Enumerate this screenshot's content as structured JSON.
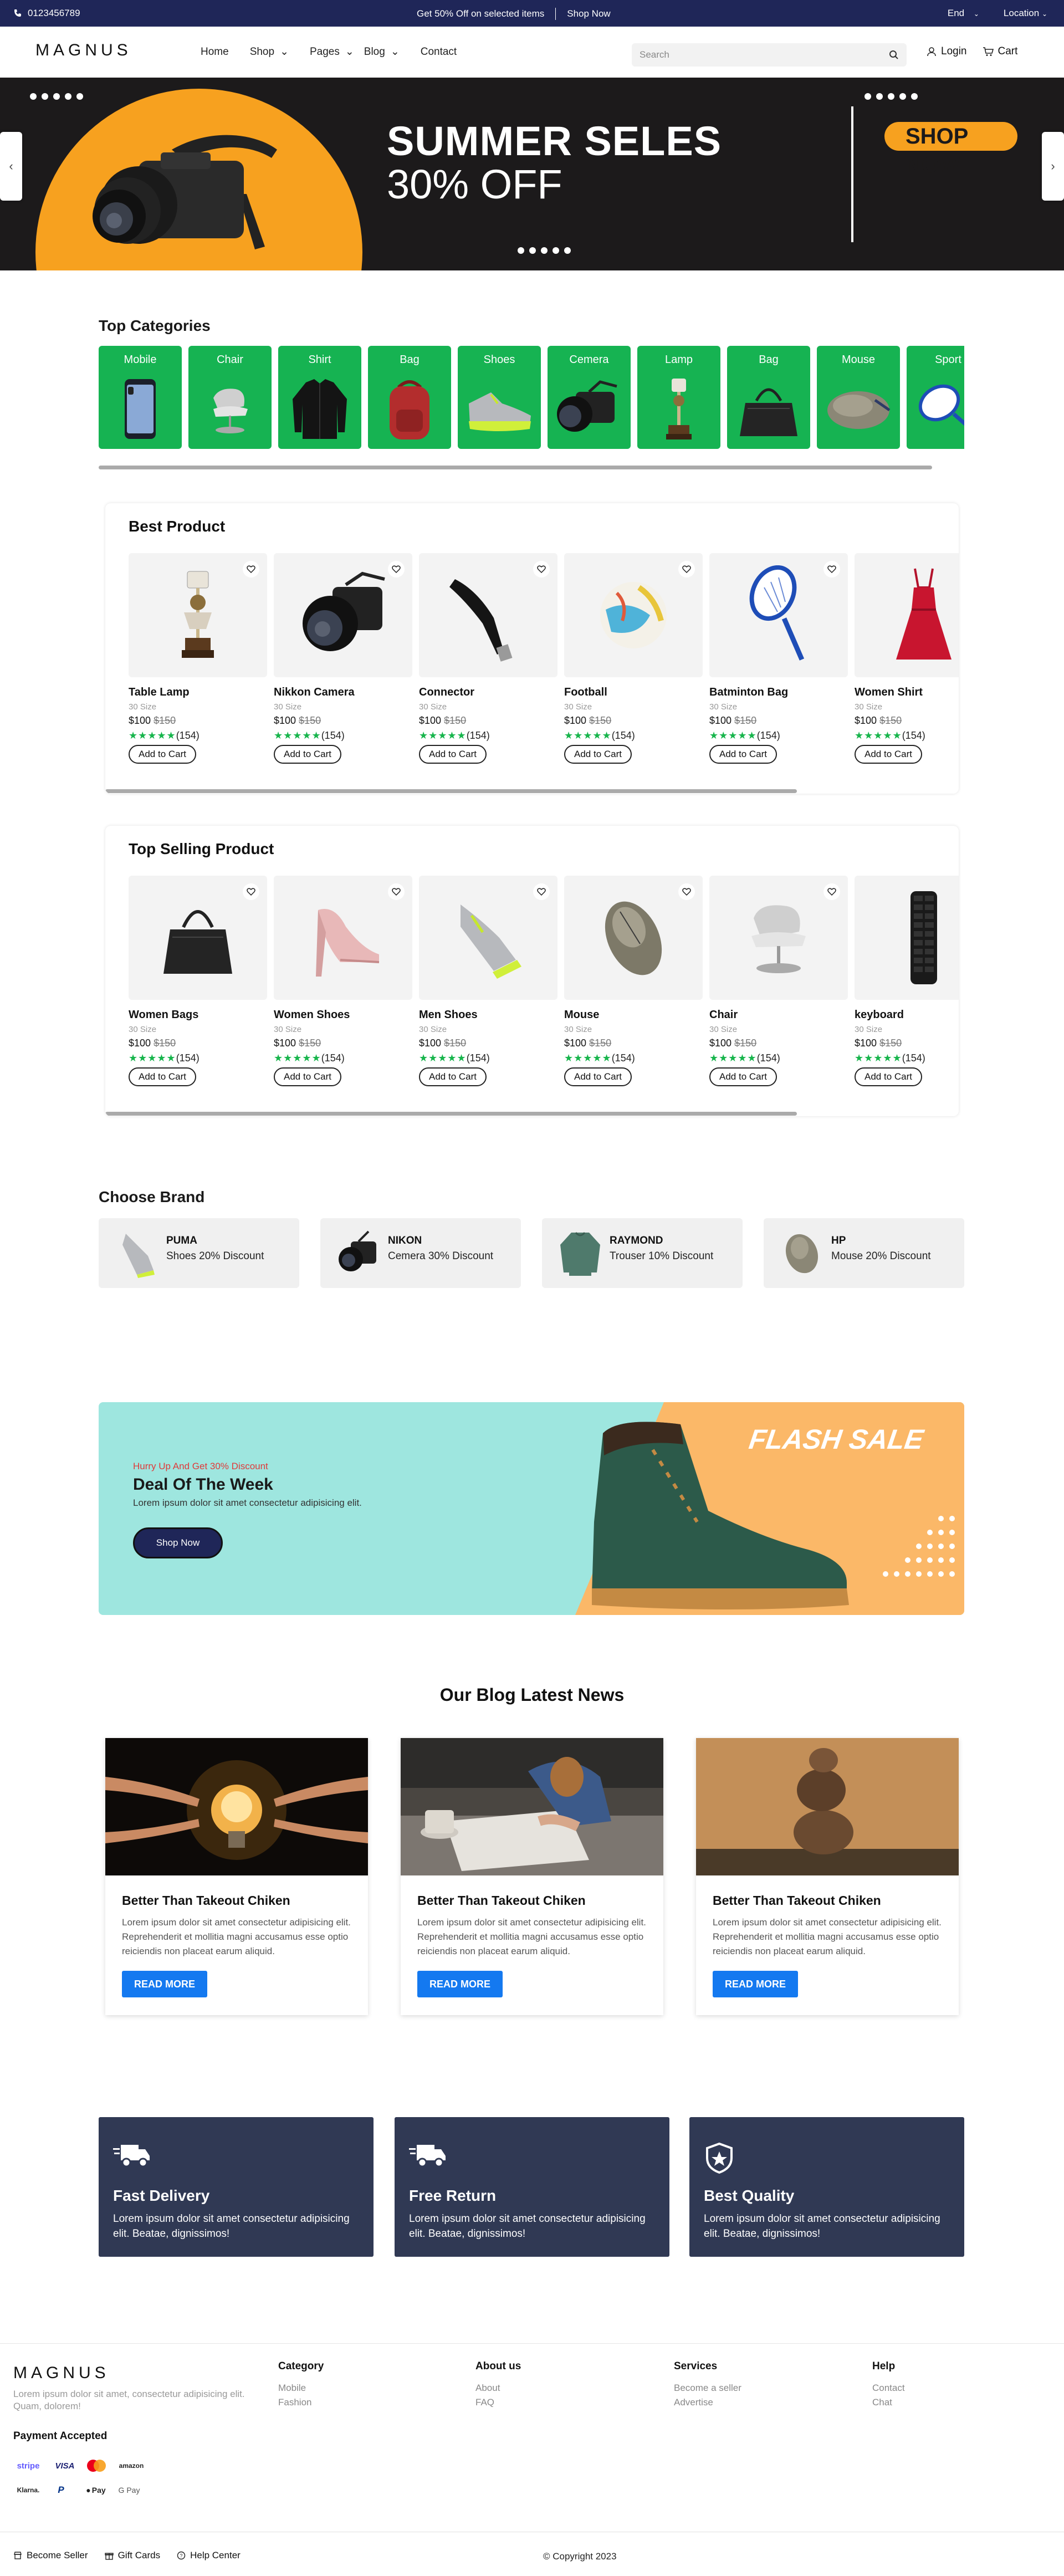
{
  "topbar": {
    "phone": "0123456789",
    "promo": "Get 50% Off on selected items",
    "promo_link": "Shop Now",
    "language": "End",
    "location": "Location"
  },
  "nav": {
    "logo": "MAGNUS",
    "menu": [
      "Home",
      "Shop",
      "Pages",
      "Blog",
      "Contact"
    ],
    "search_placeholder": "Search",
    "login": "Login",
    "cart": "Cart"
  },
  "hero": {
    "title": "SUMMER SELES",
    "subtitle": "30% OFF",
    "cta": "SHOP NOW",
    "colors": {
      "accent": "#f7a11f",
      "bg": "#1c1a1b"
    }
  },
  "categories": {
    "title": "Top Categories",
    "items": [
      "Mobile",
      "Chair",
      "Shirt",
      "Bag",
      "Shoes",
      "Cemera",
      "Lamp",
      "Bag",
      "Mouse",
      "Sport"
    ]
  },
  "best": {
    "title": "Best Product",
    "products": [
      {
        "name": "Table Lamp",
        "size": "30 Size",
        "price": "$100",
        "old": "$150",
        "stars": "★★★★★",
        "reviews": "(154)",
        "btn": "Add to Cart",
        "icon": "lamp"
      },
      {
        "name": "Nikkon Camera",
        "size": "30 Size",
        "price": "$100",
        "old": "$150",
        "stars": "★★★★★",
        "reviews": "(154)",
        "btn": "Add to Cart",
        "icon": "camera"
      },
      {
        "name": "Connector",
        "size": "30 Size",
        "price": "$100",
        "old": "$150",
        "stars": "★★★★★",
        "reviews": "(154)",
        "btn": "Add to Cart",
        "icon": "connector"
      },
      {
        "name": "Football",
        "size": "30 Size",
        "price": "$100",
        "old": "$150",
        "stars": "★★★★★",
        "reviews": "(154)",
        "btn": "Add to Cart",
        "icon": "ball"
      },
      {
        "name": "Batminton Bag",
        "size": "30 Size",
        "price": "$100",
        "old": "$150",
        "stars": "★★★★★",
        "reviews": "(154)",
        "btn": "Add to Cart",
        "icon": "racket"
      },
      {
        "name": "Women Shirt",
        "size": "30 Size",
        "price": "$100",
        "old": "$150",
        "stars": "★★★★★",
        "reviews": "(154)",
        "btn": "Add to Cart",
        "icon": "dress"
      }
    ]
  },
  "selling": {
    "title": "Top Selling Product",
    "products": [
      {
        "name": "Women Bags",
        "size": "30 Size",
        "price": "$100",
        "old": "$150",
        "stars": "★★★★★",
        "reviews": "(154)",
        "btn": "Add to Cart",
        "icon": "bag"
      },
      {
        "name": "Women Shoes",
        "size": "30 Size",
        "price": "$100",
        "old": "$150",
        "stars": "★★★★★",
        "reviews": "(154)",
        "btn": "Add to Cart",
        "icon": "heel"
      },
      {
        "name": "Men Shoes",
        "size": "30 Size",
        "price": "$100",
        "old": "$150",
        "stars": "★★★★★",
        "reviews": "(154)",
        "btn": "Add to Cart",
        "icon": "sneaker"
      },
      {
        "name": "Mouse",
        "size": "30 Size",
        "price": "$100",
        "old": "$150",
        "stars": "★★★★★",
        "reviews": "(154)",
        "btn": "Add to Cart",
        "icon": "mouse"
      },
      {
        "name": "Chair",
        "size": "30 Size",
        "price": "$100",
        "old": "$150",
        "stars": "★★★★★",
        "reviews": "(154)",
        "btn": "Add to Cart",
        "icon": "chair"
      },
      {
        "name": "keyboard",
        "size": "30 Size",
        "price": "$100",
        "old": "$150",
        "stars": "★★★★★",
        "reviews": "(154)",
        "btn": "Add to Cart",
        "icon": "keyboard"
      }
    ]
  },
  "brands": {
    "title": "Choose Brand",
    "items": [
      {
        "name": "PUMA",
        "desc": "Shoes 20% Discount"
      },
      {
        "name": "NIKON",
        "desc": "Cemera 30% Discount"
      },
      {
        "name": "RAYMOND",
        "desc": "Trouser 10% Discount"
      },
      {
        "name": "HP",
        "desc": "Mouse 20% Discount"
      }
    ]
  },
  "deal": {
    "kicker": "Hurry Up And Get 30% Discount",
    "title": "Deal Of The Week",
    "text": "Lorem ipsum dolor sit amet consectetur adipisicing elit.",
    "cta": "Shop Now",
    "badge": "FLASH SALE"
  },
  "blog": {
    "title": "Our Blog Latest News",
    "posts": [
      {
        "title": "Better Than Takeout Chiken",
        "text": "Lorem ipsum dolor sit amet consectetur adipisicing elit. Reprehenderit et mollitia magni accusamus esse optio reiciendis non placeat earum aliquid.",
        "cta": "READ MORE"
      },
      {
        "title": "Better Than Takeout Chiken",
        "text": "Lorem ipsum dolor sit amet consectetur adipisicing elit. Reprehenderit et mollitia magni accusamus esse optio reiciendis non placeat earum aliquid.",
        "cta": "READ MORE"
      },
      {
        "title": "Better Than Takeout Chiken",
        "text": "Lorem ipsum dolor sit amet consectetur adipisicing elit. Reprehenderit et mollitia magni accusamus esse optio reiciendis non placeat earum aliquid.",
        "cta": "READ MORE"
      }
    ]
  },
  "features": [
    {
      "title": "Fast Delivery",
      "text": "Lorem ipsum dolor sit amet consectetur adipisicing elit. Beatae, dignissimos!"
    },
    {
      "title": "Free Return",
      "text": "Lorem ipsum dolor sit amet consectetur adipisicing elit. Beatae, dignissimos!"
    },
    {
      "title": "Best Quality",
      "text": "Lorem ipsum dolor sit amet consectetur adipisicing elit. Beatae, dignissimos!"
    }
  ],
  "footer": {
    "logo": "MAGNUS",
    "about": "Lorem ipsum dolor sit amet, consectetur adipisicing elit. Quam, dolorem!",
    "payment_title": "Payment Accepted",
    "payments": [
      "stripe",
      "VISA",
      "mastercard",
      "amazon",
      "Klarna.",
      "P",
      "Pay",
      "G Pay"
    ],
    "columns": [
      {
        "title": "Category",
        "links": [
          "Mobile",
          "Fashion"
        ]
      },
      {
        "title": "About us",
        "links": [
          "About",
          "FAQ"
        ]
      },
      {
        "title": "Services",
        "links": [
          "Become a seller",
          "Advertise"
        ]
      },
      {
        "title": "Help",
        "links": [
          "Contact",
          "Chat"
        ]
      }
    ],
    "bottom": [
      "Become Seller",
      "Gift Cards",
      "Help Center"
    ],
    "copyright": "© Copyright 2023"
  }
}
